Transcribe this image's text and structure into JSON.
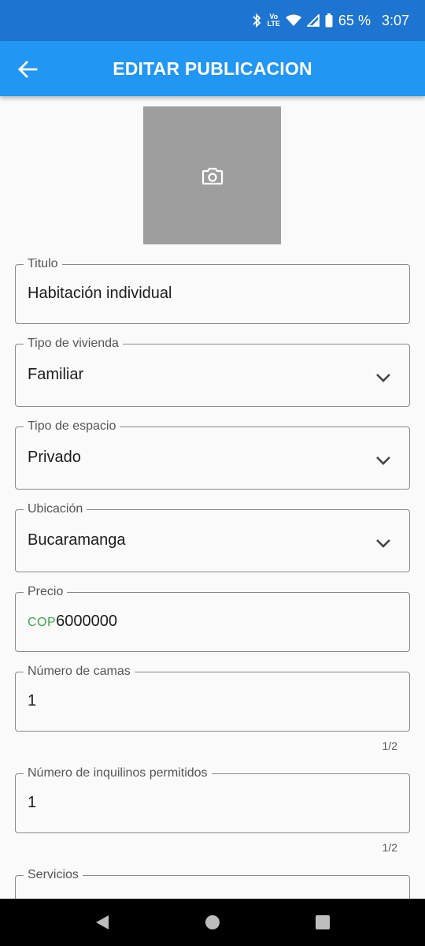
{
  "status_bar": {
    "volte_line1": "Vo",
    "volte_line2": "LTE",
    "battery": "65 %",
    "time": "3:07"
  },
  "app_bar": {
    "title": "EDITAR PUBLICACION"
  },
  "form": {
    "titulo": {
      "label": "Titulo",
      "value": "Habitación individual"
    },
    "tipo_vivienda": {
      "label": "Tipo de vivienda",
      "value": "Familiar"
    },
    "tipo_espacio": {
      "label": "Tipo de espacio",
      "value": "Privado"
    },
    "ubicacion": {
      "label": "Ubicación",
      "value": "Bucaramanga"
    },
    "precio": {
      "label": "Precio",
      "prefix": "COP",
      "value": "6000000"
    },
    "camas": {
      "label": "Número de camas",
      "value": "1",
      "counter": "1/2"
    },
    "inquilinos": {
      "label": "Número de inquilinos permitidos",
      "value": "1",
      "counter": "1/2"
    },
    "servicios": {
      "label": "Servicios"
    }
  },
  "colors": {
    "status_bar": "#1e74d1",
    "app_bar": "#2196f3",
    "photo_placeholder": "#9e9e9e",
    "prefix": "#3aa64a"
  }
}
